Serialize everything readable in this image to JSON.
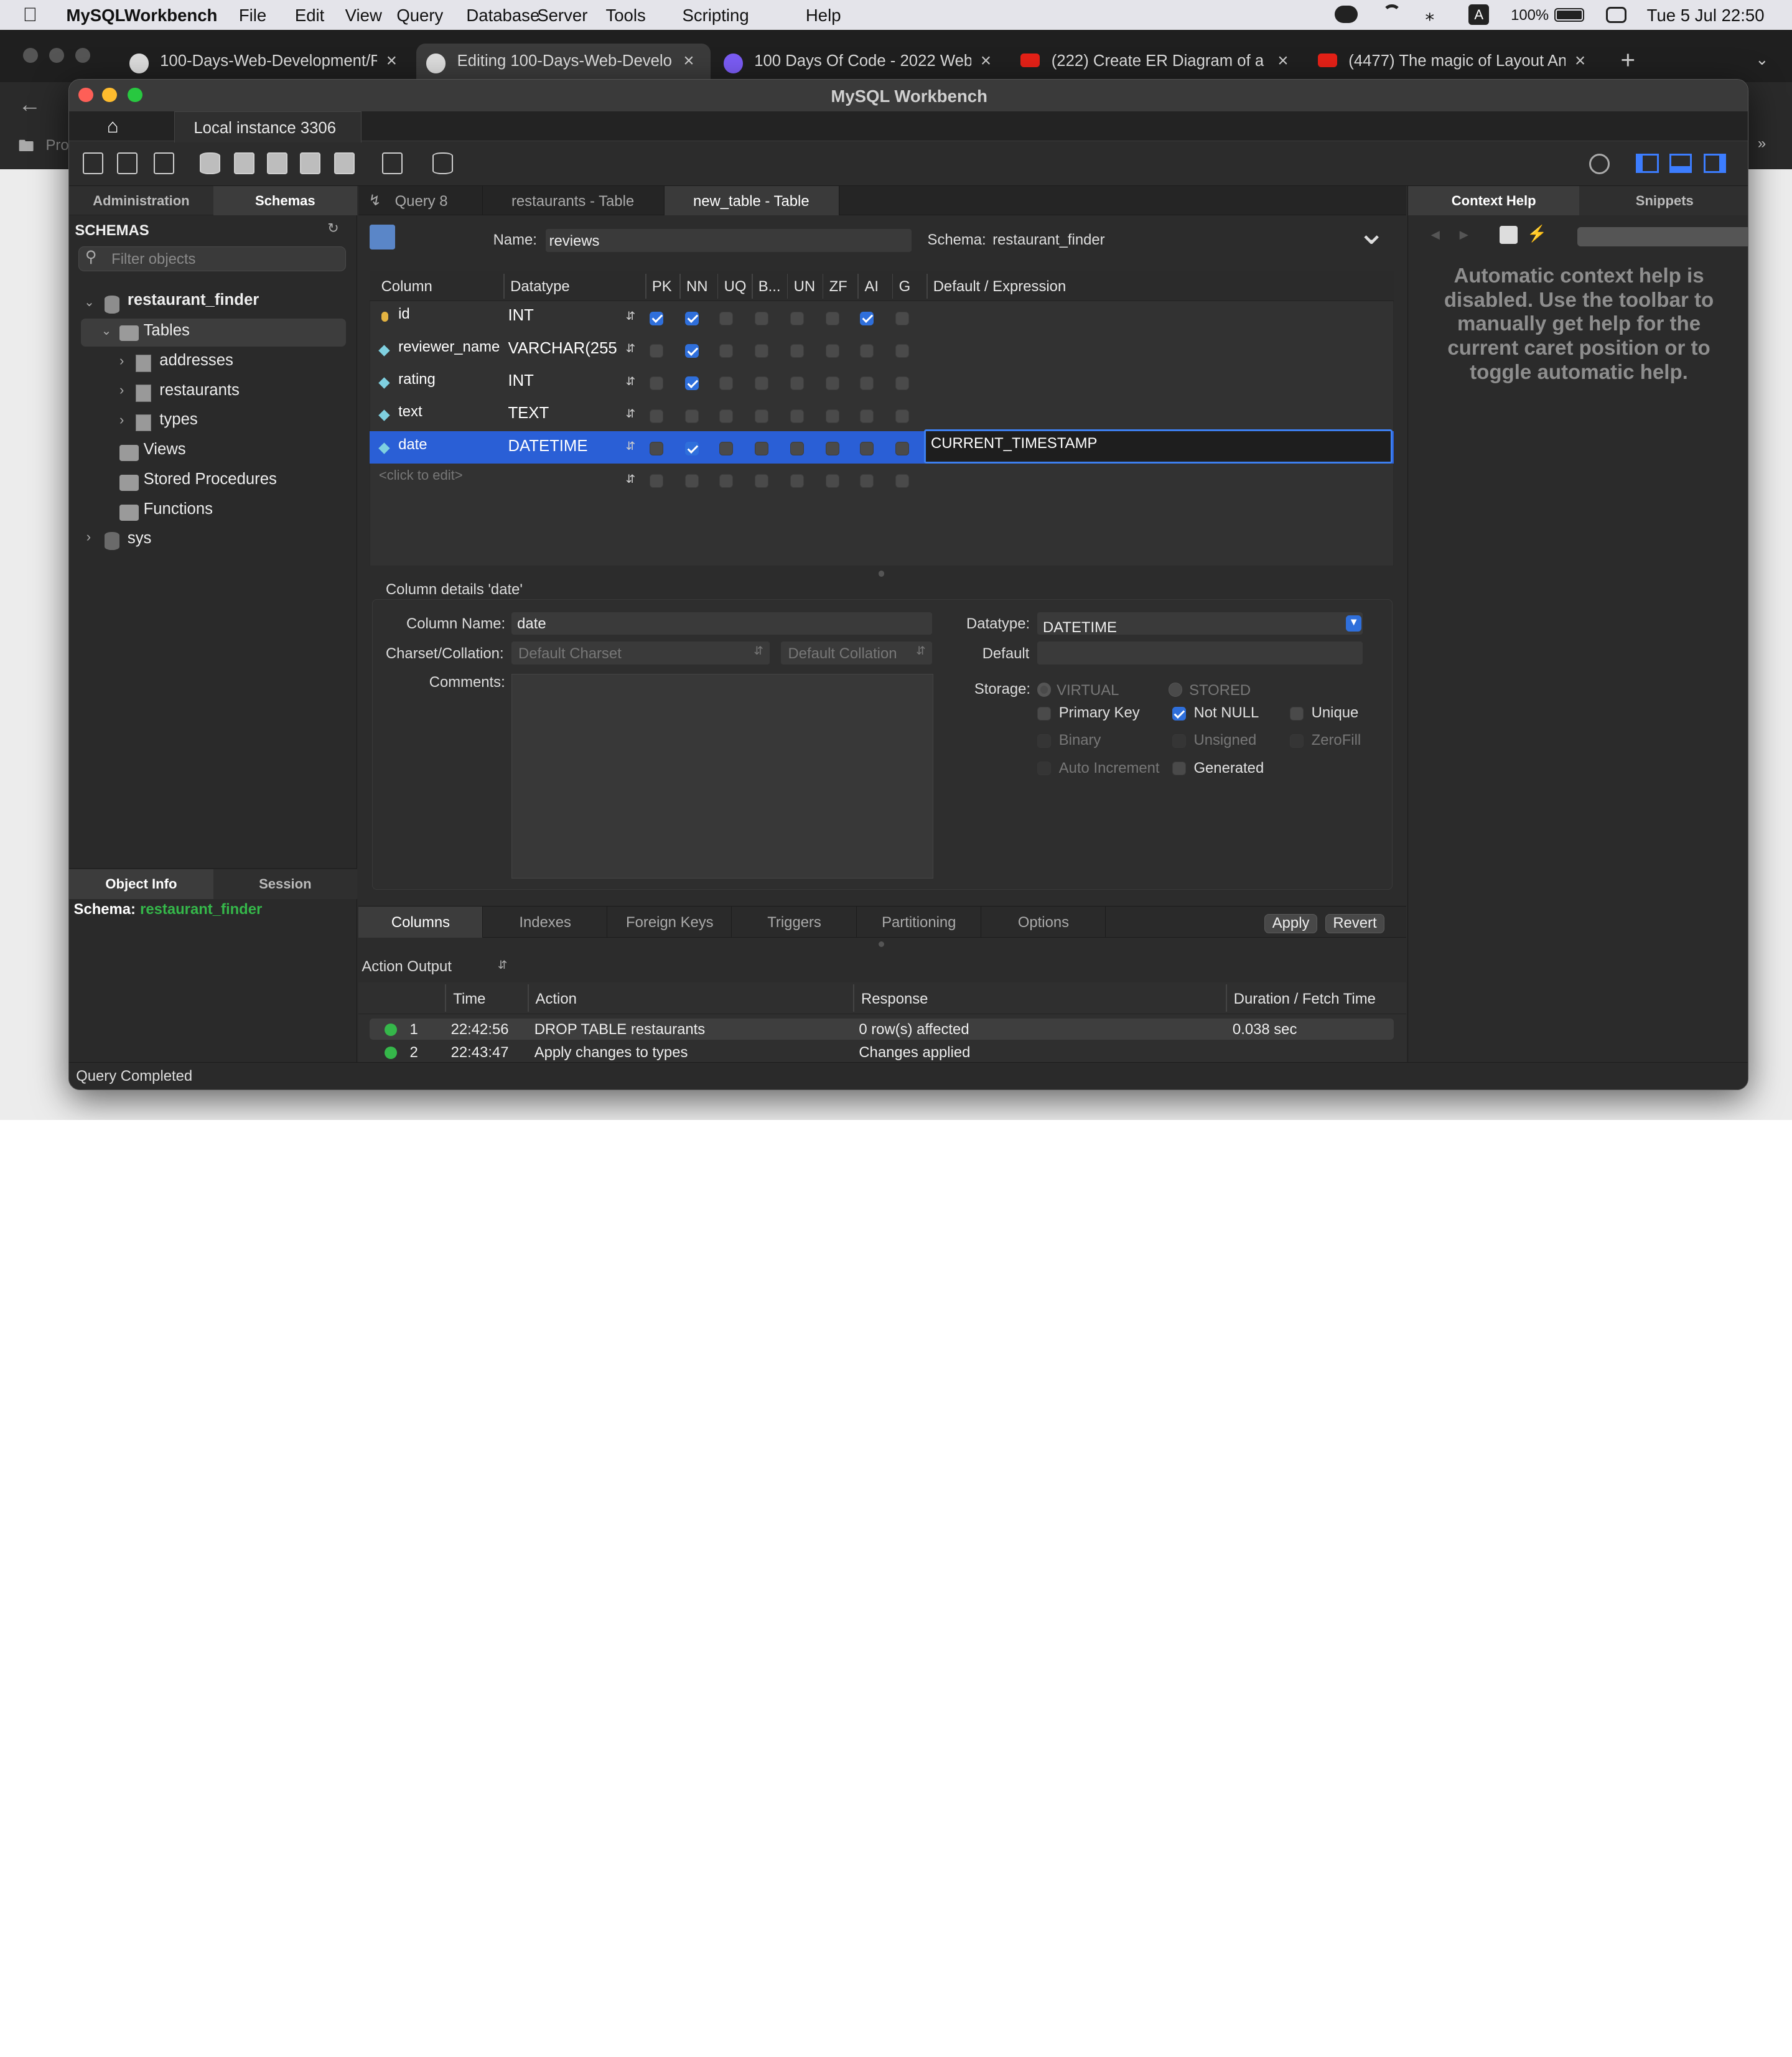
{
  "menubar": {
    "app": "MySQLWorkbench",
    "items": [
      "File",
      "Edit",
      "View",
      "Query",
      "Database",
      "Server",
      "Tools",
      "Scripting",
      "Help"
    ],
    "battery": "100%",
    "clock": "Tue 5 Jul  22:50"
  },
  "browser": {
    "tabs": [
      "100-Days-Web-Development/R",
      "Editing 100-Days-Web-Develo",
      "100 Days Of Code - 2022 Web",
      "(222) Create ER Diagram of a D",
      "(4477) The magic of Layout An"
    ],
    "new_tab": "+",
    "bookmark": "Pro"
  },
  "window": {
    "title": "MySQL Workbench",
    "instance_tab": "Local instance 3306"
  },
  "sidebar": {
    "tabs": [
      "Administration",
      "Schemas"
    ],
    "header": "SCHEMAS",
    "filter_placeholder": "Filter objects",
    "tree": {
      "schema": "restaurant_finder",
      "tables": "Tables",
      "table_items": [
        "addresses",
        "restaurants",
        "types"
      ],
      "views": "Views",
      "procs": "Stored Procedures",
      "funcs": "Functions",
      "sys": "sys"
    },
    "bottom_tabs": [
      "Object Info",
      "Session"
    ],
    "schema_label": "Schema:",
    "schema_value": "restaurant_finder"
  },
  "editor_tabs": [
    "Query 8",
    "restaurants - Table",
    "new_table - Table"
  ],
  "table_editor": {
    "name_label": "Name:",
    "name_value": "reviews",
    "schema_label": "Schema:",
    "schema_value": "restaurant_finder",
    "columns_header": [
      "Column",
      "Datatype",
      "PK",
      "NN",
      "UQ",
      "B...",
      "UN",
      "ZF",
      "AI",
      "G",
      "Default / Expression"
    ],
    "rows": [
      {
        "name": "id",
        "type": "INT",
        "flags": [
          1,
          1,
          0,
          0,
          0,
          0,
          1,
          0
        ],
        "default": ""
      },
      {
        "name": "reviewer_name",
        "type": "VARCHAR(255",
        "flags": [
          0,
          1,
          0,
          0,
          0,
          0,
          0,
          0
        ],
        "default": ""
      },
      {
        "name": "rating",
        "type": "INT",
        "flags": [
          0,
          1,
          0,
          0,
          0,
          0,
          0,
          0
        ],
        "default": ""
      },
      {
        "name": "text",
        "type": "TEXT",
        "flags": [
          0,
          0,
          0,
          0,
          0,
          0,
          0,
          0
        ],
        "default": ""
      },
      {
        "name": "date",
        "type": "DATETIME",
        "flags": [
          0,
          1,
          0,
          0,
          0,
          0,
          0,
          0
        ],
        "default": "CURRENT_TIMESTAMP"
      }
    ],
    "click_to_edit": "<click to edit>"
  },
  "details": {
    "title": "Column details 'date'",
    "col_name_label": "Column Name:",
    "col_name": "date",
    "charset_label": "Charset/Collation:",
    "charset": "Default Charset",
    "collation": "Default Collation",
    "comments_label": "Comments:",
    "datatype_label": "Datatype:",
    "datatype": "DATETIME",
    "default_label": "Default",
    "storage_label": "Storage:",
    "virtual": "VIRTUAL",
    "stored": "STORED",
    "checks": [
      {
        "label": "Primary Key",
        "on": false,
        "dis": false
      },
      {
        "label": "Not NULL",
        "on": true,
        "dis": false
      },
      {
        "label": "Unique",
        "on": false,
        "dis": false
      },
      {
        "label": "Binary",
        "on": false,
        "dis": true
      },
      {
        "label": "Unsigned",
        "on": false,
        "dis": true
      },
      {
        "label": "ZeroFill",
        "on": false,
        "dis": true
      },
      {
        "label": "Auto Increment",
        "on": false,
        "dis": true
      },
      {
        "label": "Generated",
        "on": false,
        "dis": false
      }
    ]
  },
  "bottom_tabs": [
    "Columns",
    "Indexes",
    "Foreign Keys",
    "Triggers",
    "Partitioning",
    "Options"
  ],
  "apply": "Apply",
  "revert": "Revert",
  "output": {
    "selector": "Action Output",
    "headers": [
      "Time",
      "Action",
      "Response",
      "Duration / Fetch Time"
    ],
    "rows": [
      {
        "n": "1",
        "time": "22:42:56",
        "action": "DROP TABLE restaurants",
        "response": "0 row(s) affected",
        "dur": "0.038 sec"
      },
      {
        "n": "2",
        "time": "22:43:47",
        "action": "Apply changes to types",
        "response": "Changes applied",
        "dur": ""
      }
    ]
  },
  "right": {
    "tabs": [
      "Context Help",
      "Snippets"
    ],
    "help": "Automatic context help is disabled. Use the toolbar to manually get help for the current caret position or to toggle automatic help."
  },
  "status": "Query Completed"
}
